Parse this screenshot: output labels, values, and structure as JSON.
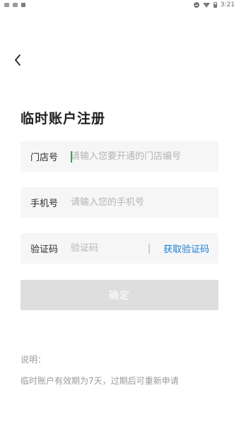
{
  "status_bar": {
    "time": "3:21",
    "icons": [
      "image-icon",
      "image-icon",
      "app-a-icon",
      "do-not-disturb-icon",
      "wifi-icon",
      "battery-icon"
    ]
  },
  "header": {
    "back_icon": "chevron-left-icon"
  },
  "page": {
    "title": "临时账户注册"
  },
  "form": {
    "store_label": "门店号",
    "store_placeholder": "请输入您要开通的门店编号",
    "store_value": "",
    "phone_label": "手机号",
    "phone_placeholder": "请输入您的手机号",
    "phone_value": "",
    "code_label": "验证码",
    "code_placeholder": "验证码",
    "code_value": "",
    "get_code_label": "获取验证码",
    "confirm_label": "确定"
  },
  "note": {
    "title": "说明：",
    "text": "临时账户有效期为7天，过期后可重新申请"
  },
  "colors": {
    "accent": "#1a7fd4",
    "button_disabled": "#dedede",
    "field_bg": "#f6f6f6",
    "cursor": "#43a047"
  }
}
